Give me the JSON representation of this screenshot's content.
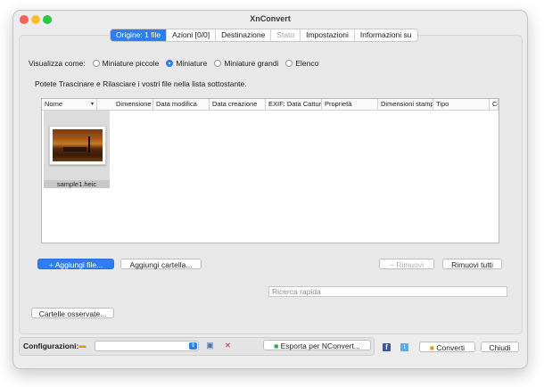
{
  "window": {
    "title": "XnConvert"
  },
  "tabs": [
    {
      "label": "Origine: 1 file",
      "state": "active"
    },
    {
      "label": "Azioni [0/0]",
      "state": "normal"
    },
    {
      "label": "Destinazione",
      "state": "normal"
    },
    {
      "label": "Stato",
      "state": "disabled"
    },
    {
      "label": "Impostazioni",
      "state": "normal"
    },
    {
      "label": "Informazioni su",
      "state": "normal"
    }
  ],
  "view": {
    "label": "Visualizza come:",
    "options": [
      {
        "label": "Miniature piccole",
        "selected": false
      },
      {
        "label": "Miniature",
        "selected": true
      },
      {
        "label": "Miniature grandi",
        "selected": false
      },
      {
        "label": "Elenco",
        "selected": false
      }
    ]
  },
  "hint": "Potete Trascinare e Rilasciare i vostri file nella lista sottostante.",
  "list": {
    "columns": [
      "Nome",
      "Dimensione",
      "Data modifica",
      "Data creazione",
      "EXIF: Data Cattura",
      "Proprietà",
      "Dimensioni stamp",
      "Tipo",
      "Co"
    ],
    "files": [
      {
        "name": "sample1.heic"
      }
    ]
  },
  "buttons": {
    "add_files": "Aggiungi file...",
    "add_folder": "Aggiungi cartella...",
    "remove": "Rimuovi",
    "remove_all": "Rimuovi tutti",
    "watched_folders": "Cartelle osservate...",
    "export": "Esporta per NConvert...",
    "convert": "Converti",
    "close": "Chiudi"
  },
  "search": {
    "placeholder": "Ricerca rapida"
  },
  "config": {
    "label": "Configurazioni:",
    "value": ""
  },
  "colors": {
    "accent": "#2f7ef0"
  }
}
